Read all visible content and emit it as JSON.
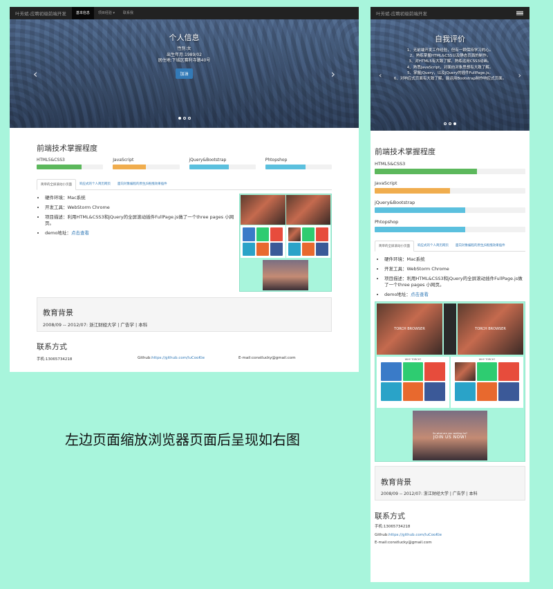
{
  "caption": "左边页面缩放浏览器页面后呈现如右图",
  "navbar": {
    "brand": "叶芳斌-应聘初级前端开发",
    "items": [
      "基本信息",
      "项目经验 ▾",
      "联系我"
    ],
    "active_index": 0
  },
  "carousel_left": {
    "title": "个人信息",
    "lines": [
      "性别:女",
      "出生年月:1989/02",
      "居住地:下城区赛利寺路40号"
    ],
    "button": "加油",
    "prev": "‹",
    "next": "›"
  },
  "carousel_right": {
    "title": "自我评价",
    "lines": [
      "1、无前端开发工作经验，但有一颗保持学习的心。",
      "2、熟练掌握HTML&CSS以及静态页面的制作。",
      "3、对HTML5有大致了解，熟练运用CSS3动画。",
      "4、熟悉JavaScript，对面向对象思想有大致了解。",
      "5、掌握jQuery，以及jQuery的插件FullPage.js。",
      "6、对响应式页面有大致了解，能运用Bootstrap制作响应式页面。"
    ],
    "prev": "‹",
    "next": "›"
  },
  "skills": {
    "title": "前端技术掌握程度",
    "items": [
      {
        "name": "HTML5&CSS3",
        "level": 0.68,
        "color": "#5cb85c"
      },
      {
        "name": "JavaScript",
        "level": 0.5,
        "color": "#f0ad4e"
      },
      {
        "name": "jQuery&Bootstrap",
        "level": 0.6,
        "color": "#5bc0de"
      },
      {
        "name": "Phtopshop",
        "level": 0.6,
        "color": "#5bc0de"
      }
    ]
  },
  "tabs": [
    "简单的全屏滚动小页面",
    "响应式的个人简历网页",
    "面向对象编程的原生JS拖拽效果插件"
  ],
  "project": {
    "bullets": [
      "硬件环境：Mac系统",
      "开发工具：WebStorm Chrome",
      "项目描述：利用HTML&CSS3和jQuery的全屏滚动插件FullPage.js做了一个three pages 小网页。"
    ],
    "demo_label": "demo地址：",
    "demo_link": "点击查看"
  },
  "preview": {
    "hero_text": "TORCH BROWSER",
    "tiles_title": "WHY TORCH?",
    "join_text": "JOIN US NOW!",
    "sub_text": "So what are you waiting for?",
    "tile_colors": [
      "#3a7bc8",
      "#2ecc71",
      "#e74c3c",
      "#2aa3c8",
      "#e8692e",
      "#3b5998"
    ]
  },
  "education": {
    "title": "教育背景",
    "detail": "2008/09 -- 2012/07:  浙江财经大学 | 广告学 | 本科"
  },
  "contact": {
    "title": "联系方式",
    "phone": "手机:13065734218",
    "github_label": "Github:",
    "github_url": "https://github.com/luCooKie",
    "email": "E-mail:constlucky@gmail.com"
  }
}
